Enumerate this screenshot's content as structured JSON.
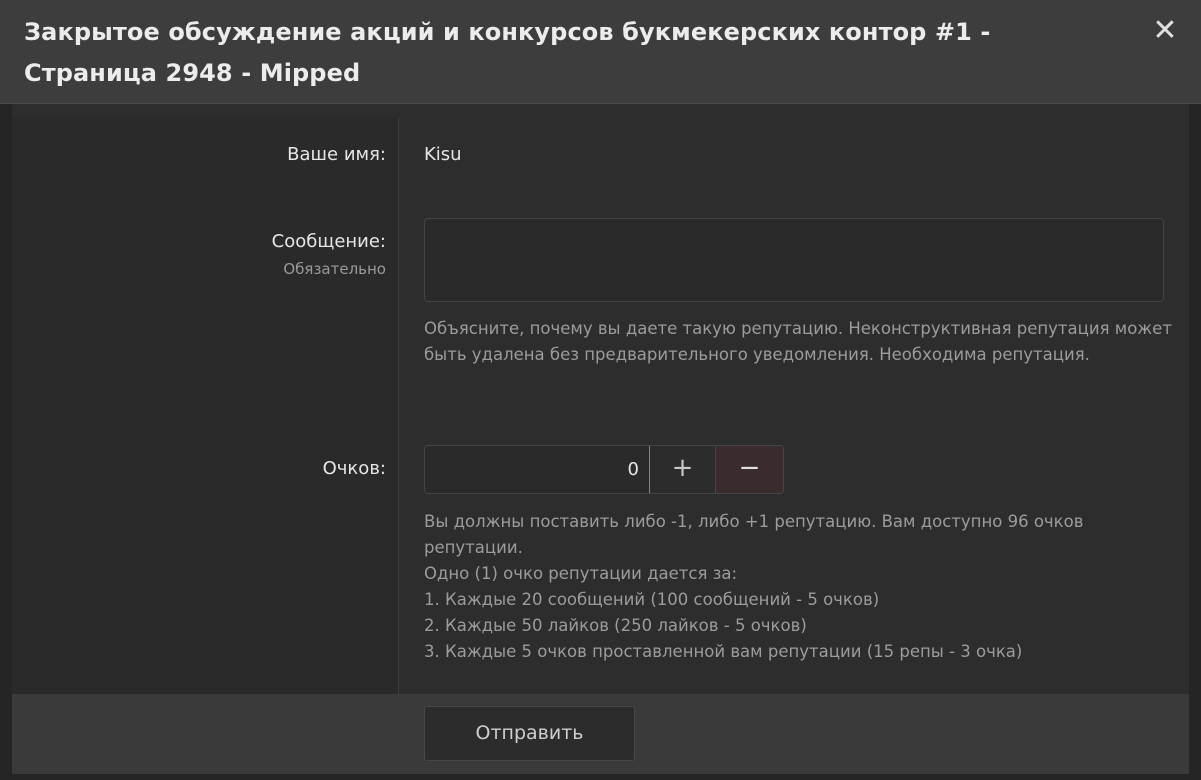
{
  "dialog": {
    "title": "Закрытое обсуждение акций и конкурсов букмекерских контор #1 - Страница 2948 - Mipped",
    "close_icon": "close-icon"
  },
  "form": {
    "name_label": "Ваше имя:",
    "name_value": "Kisu",
    "message_label": "Сообщение:",
    "message_hint": "Обязательно",
    "message_value": "",
    "message_explain": "Объясните, почему вы даете такую репутацию. Неконструктивная репутация может быть удалена без предварительного уведомления. Необходима репутация.",
    "points_label": "Очков:",
    "points_value": "0",
    "plus_label": "+",
    "minus_label": "−",
    "points_explain_1": "Вы должны поставить либо -1, либо +1 репутацию. Вам доступно 96 очков репутации.",
    "points_explain_2": "Одно (1) очко репутации дается за:",
    "points_explain_3": "1. Каждые 20 сообщений (100 сообщений - 5 очков)",
    "points_explain_4": "2. Каждые 50 лайков (250 лайков - 5 очков)",
    "points_explain_5": "3. Каждые 5 очков проставленной вам репутации (15 репы - 3 очка)"
  },
  "footer": {
    "submit_label": "Отправить"
  },
  "colors": {
    "header_bg": "#3d3d3d",
    "body_bg": "#2d2d2d",
    "minus_bg": "#3a2c2c",
    "focus_accent": "#4a90d9"
  }
}
